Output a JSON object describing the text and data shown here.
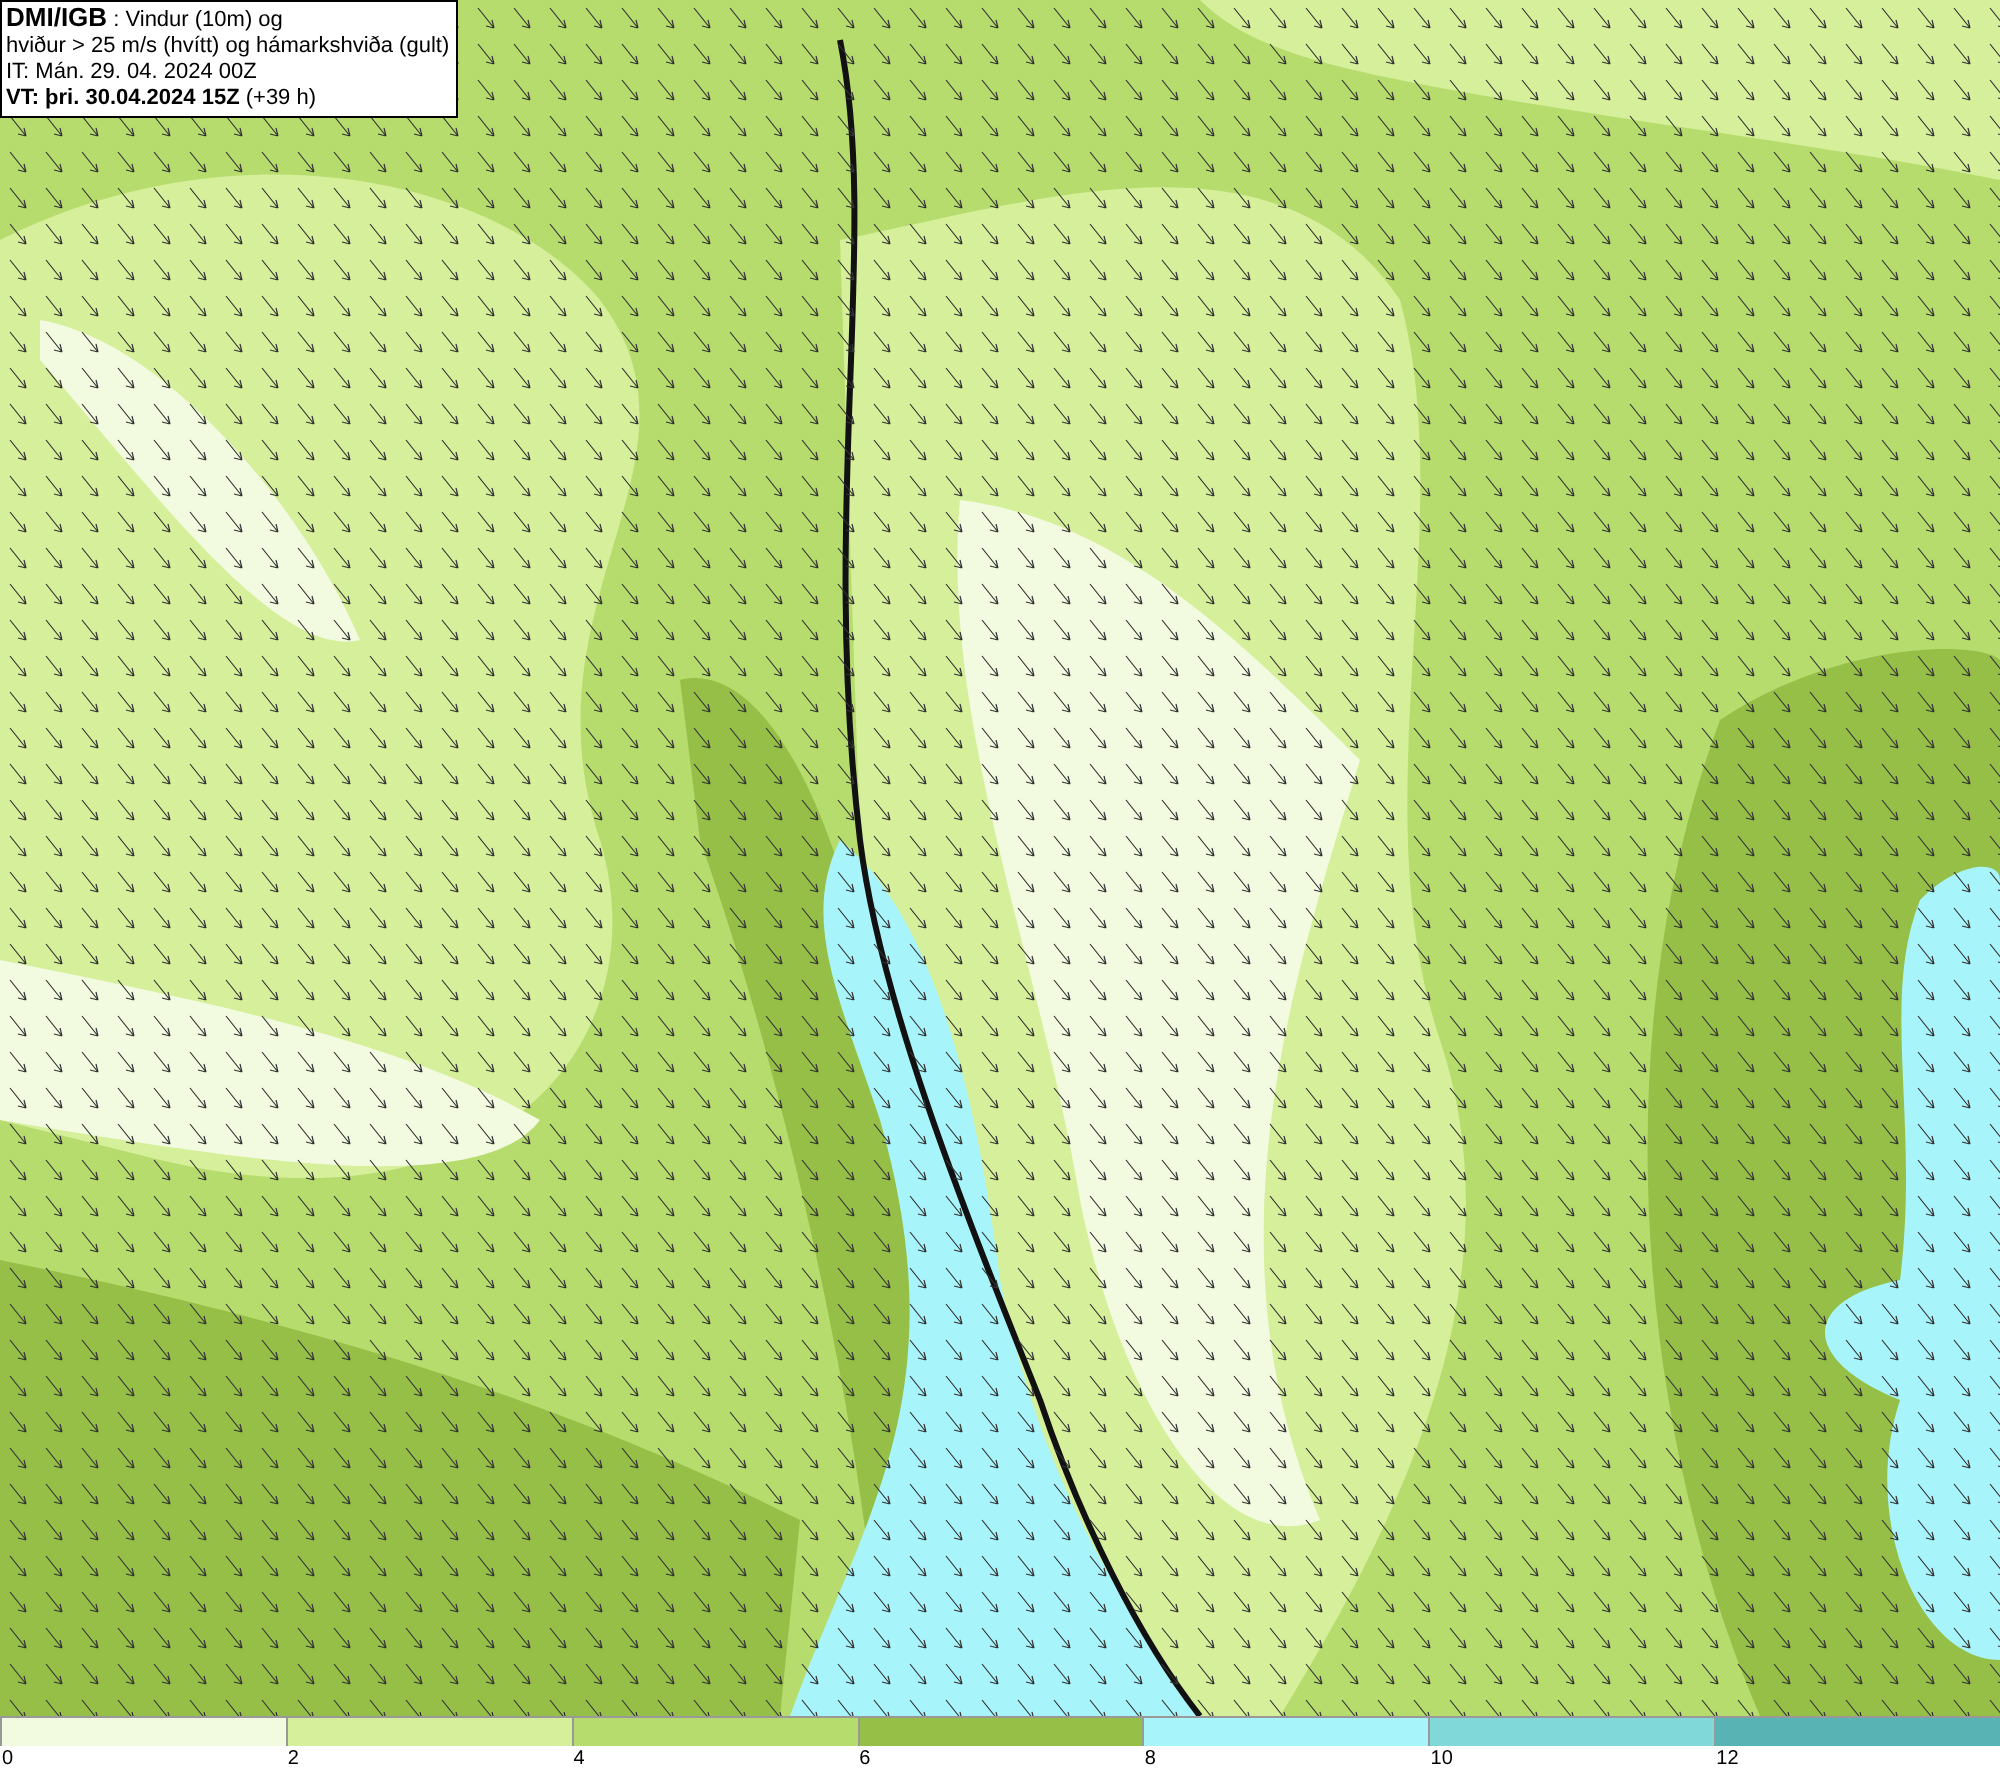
{
  "title_box": {
    "lines": [
      "**DMI/IGB** : Vindur (10m) og",
      "hviður > 25 m/s (hvítt) og hámarkshviða (gult)",
      "IT: Mán. 29. 04. 2024 00Z",
      "**VT: þri. 30.04.2024 15Z** (+39 h)"
    ]
  },
  "legend": {
    "bins": [
      {
        "label": "0",
        "color": "#f2fbe0"
      },
      {
        "label": "2",
        "color": "#d6ef9a"
      },
      {
        "label": "4",
        "color": "#b6dc6e"
      },
      {
        "label": "6",
        "color": "#96bf48"
      },
      {
        "label": "8",
        "color": "#a8f4fb"
      },
      {
        "label": "10",
        "color": "#80d8d8"
      },
      {
        "label": "12",
        "color": "#58b4b4"
      }
    ]
  }
}
